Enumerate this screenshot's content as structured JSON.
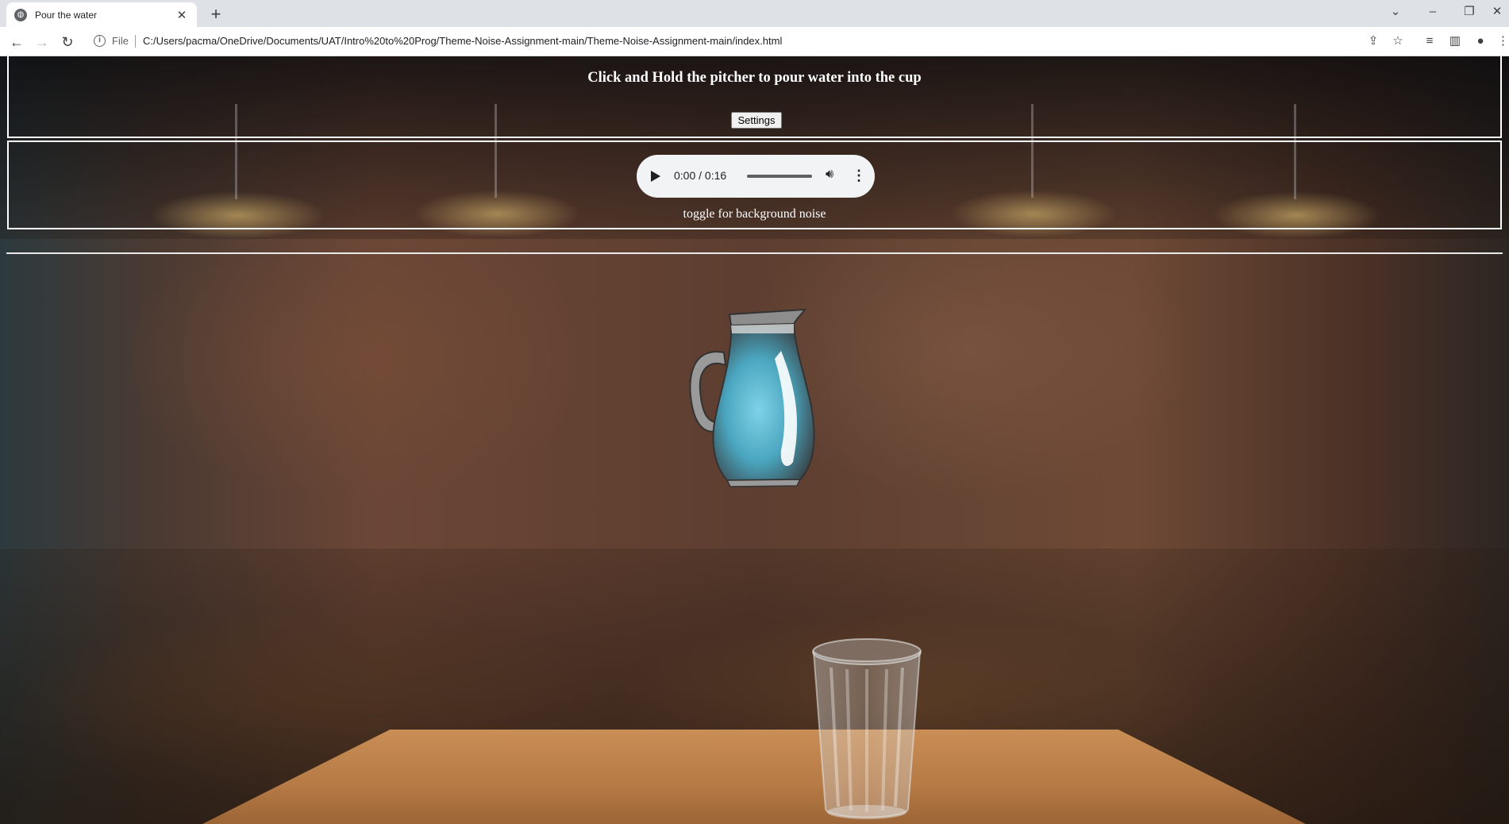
{
  "browser": {
    "tab_title": "Pour the water",
    "new_tab": "+",
    "address_prefix": "File",
    "url": "C:/Users/pacma/OneDrive/Documents/UAT/Intro%20to%20Prog/Theme-Noise-Assignment-main/Theme-Noise-Assignment-main/index.html"
  },
  "page": {
    "instruction": "Click and Hold the pitcher to pour water into the cup",
    "settings_label": "Settings",
    "audio": {
      "time": "0:00 / 0:16",
      "progress": 0
    },
    "toggle_label": "toggle for background noise"
  },
  "icons": {
    "back": "arrow-left-icon",
    "forward": "arrow-right-icon",
    "reload": "reload-icon",
    "info": "info-icon",
    "share": "share-icon",
    "star": "star-icon",
    "reading_list": "reading-list-icon",
    "side_panel": "side-panel-icon",
    "profile": "profile-icon",
    "menu": "kebab-menu-icon"
  }
}
